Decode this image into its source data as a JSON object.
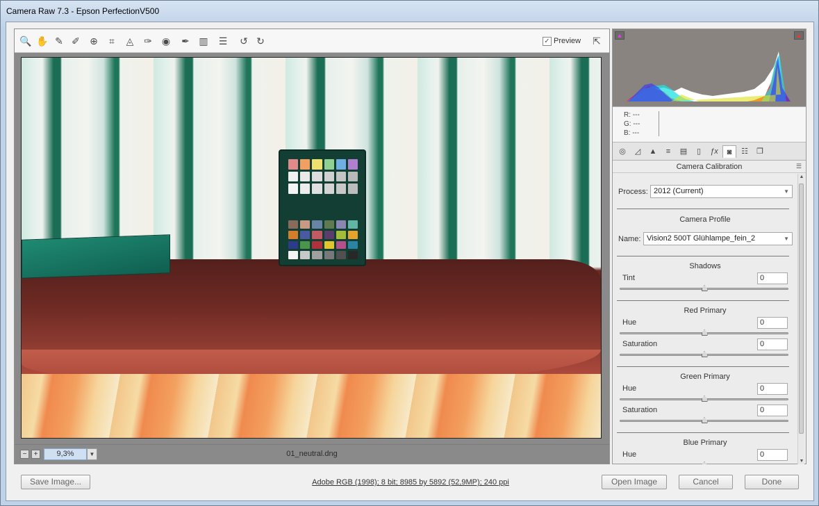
{
  "window": {
    "title": "Camera Raw 7.3  -  Epson PerfectionV500"
  },
  "toolbar": {
    "tools": [
      {
        "name": "zoom-tool",
        "glyph": "🔍"
      },
      {
        "name": "hand-tool",
        "glyph": "✋"
      },
      {
        "name": "white-balance-tool",
        "glyph": "✎"
      },
      {
        "name": "color-sampler-tool",
        "glyph": "✐"
      },
      {
        "name": "targeted-adjustment-tool",
        "glyph": "⊕"
      },
      {
        "name": "crop-tool",
        "glyph": "⌗"
      },
      {
        "name": "straighten-tool",
        "glyph": "◬"
      },
      {
        "name": "spot-removal-tool",
        "glyph": "✑"
      },
      {
        "name": "red-eye-tool",
        "glyph": "◉"
      },
      {
        "name": "adjustment-brush-tool",
        "glyph": "✒"
      },
      {
        "name": "graduated-filter-tool",
        "glyph": "▥"
      },
      {
        "name": "preferences-tool",
        "glyph": "☰"
      },
      {
        "name": "rotate-left-tool",
        "glyph": "↺"
      },
      {
        "name": "rotate-right-tool",
        "glyph": "↻"
      }
    ],
    "preview_label": "Preview",
    "preview_checked": "✓"
  },
  "image": {
    "zoom_value": "9,3%",
    "filename": "01_neutral.dng"
  },
  "readout": {
    "r": "R:  ---",
    "g": "G:  ---",
    "b": "B:  ---"
  },
  "panel": {
    "title": "Camera Calibration",
    "process_label": "Process:",
    "process_value": "2012 (Current)",
    "camera_profile_title": "Camera Profile",
    "name_label": "Name:",
    "name_value": "Vision2 500T Glühlampe_fein_2",
    "sections": [
      {
        "title": "Shadows",
        "rows": [
          {
            "label": "Tint",
            "value": "0"
          }
        ]
      },
      {
        "title": "Red Primary",
        "rows": [
          {
            "label": "Hue",
            "value": "0"
          },
          {
            "label": "Saturation",
            "value": "0"
          }
        ]
      },
      {
        "title": "Green Primary",
        "rows": [
          {
            "label": "Hue",
            "value": "0"
          },
          {
            "label": "Saturation",
            "value": "0"
          }
        ]
      },
      {
        "title": "Blue Primary",
        "rows": [
          {
            "label": "Hue",
            "value": "0"
          }
        ]
      }
    ]
  },
  "footer": {
    "save_label": "Save Image...",
    "workflow_text": "Adobe RGB (1998); 8 bit; 8985 by 5892 (52,9MP); 240 ppi",
    "open_label": "Open Image",
    "cancel_label": "Cancel",
    "done_label": "Done"
  },
  "colors": {
    "histogram_bg": "#8a8480",
    "checker_patches": [
      "#8a6a5a",
      "#c89a84",
      "#6a84a8",
      "#5f7a4f",
      "#8a86b4",
      "#62b4a4",
      "#d47e2c",
      "#4a5aa0",
      "#c05a64",
      "#5c3c6a",
      "#a4bc3c",
      "#e4a42c",
      "#2c3c8a",
      "#4c944c",
      "#b0303c",
      "#e4c42c",
      "#b4508c",
      "#2c84a4",
      "#f4f4f4",
      "#c8c8c8",
      "#a0a0a0",
      "#787878",
      "#505050",
      "#282828"
    ],
    "checker_top": [
      "#e08a8a",
      "#f0a060",
      "#f0e070",
      "#90d090",
      "#70b0e0",
      "#b080d0",
      "#f0f0f0",
      "#e8e8e8",
      "#dcdcdc",
      "#d0d0d0",
      "#c4c4c4",
      "#b8b8b8",
      "#f4f4f4",
      "#ececec",
      "#e0e0e0",
      "#d4d4d4",
      "#c8c8c8",
      "#bcbcbc"
    ]
  }
}
